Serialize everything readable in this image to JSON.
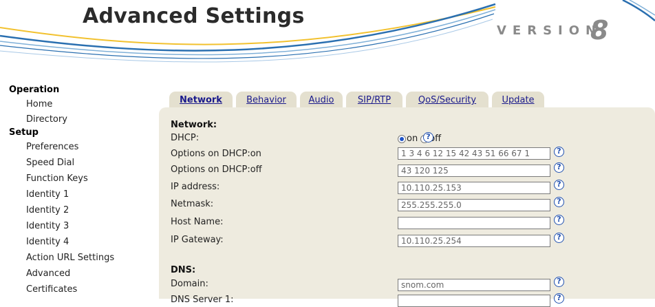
{
  "header": {
    "title": "Advanced Settings",
    "version_label": "VERSION",
    "version_number": "8"
  },
  "sidebar": {
    "sections": [
      {
        "heading": "Operation",
        "items": [
          "Home",
          "Directory"
        ]
      },
      {
        "heading": "Setup",
        "items": [
          "Preferences",
          "Speed Dial",
          "Function Keys",
          "Identity 1",
          "Identity 2",
          "Identity 3",
          "Identity 4",
          "Action URL Settings",
          "Advanced",
          "Certificates"
        ]
      }
    ]
  },
  "tabs": [
    {
      "label": "Network",
      "active": true
    },
    {
      "label": "Behavior",
      "active": false
    },
    {
      "label": "Audio",
      "active": false
    },
    {
      "label": "SIP/RTP",
      "active": false
    },
    {
      "label": "QoS/Security",
      "active": false
    },
    {
      "label": "Update",
      "active": false
    }
  ],
  "content": {
    "network_heading": "Network:",
    "dhcp": {
      "label": "DHCP:",
      "on_label": "on",
      "off_label": "off",
      "selected": "on"
    },
    "fields": [
      {
        "label": "Options on DHCP:on",
        "value": "1 3 4 6 12 15 42 43 51 66 67 1"
      },
      {
        "label": "Options on DHCP:off",
        "value": "43 120 125"
      },
      {
        "label": "IP address:",
        "value": "10.110.25.153"
      },
      {
        "label": "Netmask:",
        "value": "255.255.255.0"
      },
      {
        "label": "Host Name:",
        "value": ""
      },
      {
        "label": "IP Gateway:",
        "value": "10.110.25.254"
      }
    ],
    "dns_heading": "DNS:",
    "dns_fields": [
      {
        "label": "Domain:",
        "value": "snom.com"
      },
      {
        "label": "DNS Server 1:",
        "value": ""
      }
    ],
    "help_glyph": "?"
  },
  "colors": {
    "panel": "#eeebdf",
    "tab": "#e4e0cf",
    "link": "#1a1a8c",
    "help_icon": "#2050b0",
    "swoosh_blue": "#2a6fb0",
    "swoosh_yellow": "#f2c12e"
  }
}
